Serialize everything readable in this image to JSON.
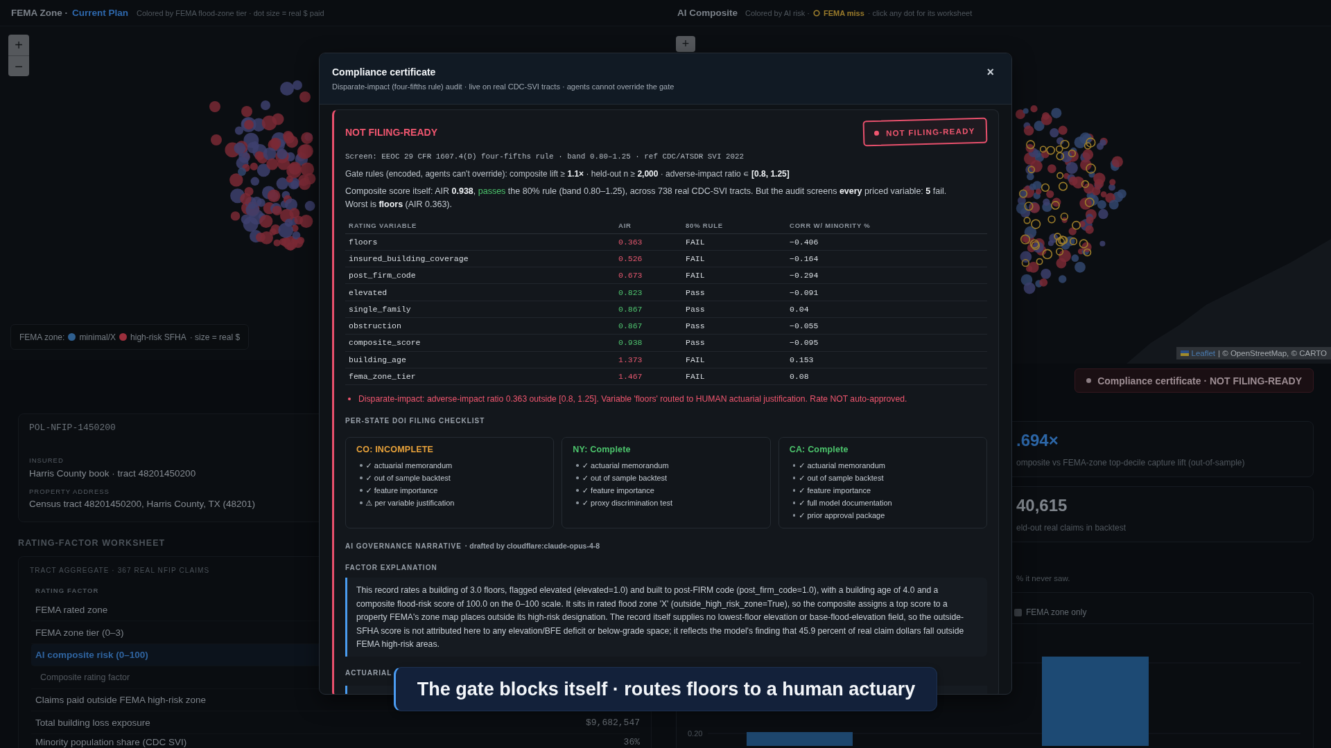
{
  "left_map": {
    "header": {
      "title": "FEMA Zone ·",
      "plan": "Current Plan",
      "caption": "Colored by FEMA flood-zone tier · dot size = real $ paid"
    },
    "zoom_buttons": [
      "+",
      "−"
    ],
    "legend": {
      "title": "FEMA zone:",
      "items": [
        {
          "label": "minimal/X",
          "color": "#2f5f8f"
        },
        {
          "label": "high-risk SFHA",
          "color": "#9a2f3c"
        }
      ],
      "note": "· size = real $"
    }
  },
  "right_map": {
    "header": {
      "title": "AI Composite",
      "caption": "Colored by AI risk ·",
      "miss_label": "FEMA miss",
      "note": "· click any dot for its worksheet"
    },
    "zoom_buttons": [
      "+"
    ],
    "attribution": {
      "link": "Leaflet",
      "text": "| © OpenStreetMap, © CARTO"
    }
  },
  "policy_card": {
    "policy_id": "POL-NFIP-1450200",
    "fields": [
      {
        "label": "INSURED",
        "value": "Harris County book · tract 48201450200"
      },
      {
        "label": "PROPERTY ADDRESS",
        "value": "Census tract 48201450200, Harris County, TX (48201)"
      }
    ]
  },
  "worksheet": {
    "title": "RATING-FACTOR WORKSHEET",
    "group": "TRACT AGGREGATE · 367 REAL NFIP CLAIMS",
    "column": "RATING FACTOR",
    "rows": [
      {
        "label": "FEMA rated zone",
        "kind": "factor",
        "selected": false
      },
      {
        "label": "FEMA zone tier (0–3)",
        "kind": "factor",
        "selected": false
      },
      {
        "label": "AI composite risk (0–100)",
        "kind": "factor",
        "selected": true
      },
      {
        "label": "Composite rating factor",
        "kind": "sub",
        "selected": false
      },
      {
        "label": "Claims paid outside FEMA high-risk zone",
        "kind": "factor",
        "selected": false
      },
      {
        "label": "Total building loss exposure",
        "kind": "factor",
        "selected": false,
        "value": "$9,682,547"
      },
      {
        "label": "Minority population share (CDC SVI)",
        "kind": "factor",
        "selected": false,
        "value": "36%"
      }
    ]
  },
  "compliance_button": {
    "label": "Compliance certificate · NOT FILING-READY"
  },
  "metrics": [
    {
      "value": ".694×",
      "caption": "omposite vs FEMA-zone top-decile capture lift (out-of-sample)",
      "kind": "accent"
    },
    {
      "value": "40,615",
      "caption": "eld-out real claims in backtest",
      "kind": "plain"
    }
  ],
  "note": "% it never saw.",
  "chart": {
    "legend": "FEMA zone only",
    "tick": "0.20"
  },
  "certificate": {
    "title": "Compliance certificate",
    "subtitle": "Disparate-impact (four-fifths rule) audit · live on real CDC-SVI tracts · agents cannot override the gate",
    "close": "×",
    "verdict": {
      "ready": false,
      "title": "NOT FILING-READY",
      "stamp": "NOT FILING-READY"
    },
    "screen": "Screen: EEOC 29 CFR 1607.4(D) four-fifths rule · band 0.80–1.25 · ref CDC/ATSDR SVI 2022",
    "gate_rules": "Gate rules (encoded, agents can't override): composite lift ≥ **1.1×** · held-out n ≥ **2,000** · adverse-impact ratio ∊ **[0.8, 1.25]**",
    "summary": [
      {
        "text": "Composite score itself: AIR **0.938**, ",
        "pass": false
      },
      {
        "text": "passes",
        "pass": true
      },
      {
        "text": " the 80% rule (band 0.80–1.25), across 738 real CDC-SVI tracts. But the audit screens **every** priced variable: **5** fail. Worst is **floors** (AIR 0.363).",
        "pass": false
      }
    ],
    "table": {
      "columns": [
        "RATING VARIABLE",
        "AIR",
        "80% RULE",
        "CORR W/ MINORITY %"
      ],
      "rows": [
        {
          "variable": "floors",
          "air": "0.363",
          "rule": "FAIL",
          "corr": "−0.406",
          "pass": false
        },
        {
          "variable": "insured_building_coverage",
          "air": "0.526",
          "rule": "FAIL",
          "corr": "−0.164",
          "pass": false
        },
        {
          "variable": "post_firm_code",
          "air": "0.673",
          "rule": "FAIL",
          "corr": "−0.294",
          "pass": false
        },
        {
          "variable": "elevated",
          "air": "0.823",
          "rule": "Pass",
          "corr": "−0.091",
          "pass": true
        },
        {
          "variable": "single_family",
          "air": "0.867",
          "rule": "Pass",
          "corr": "0.04",
          "pass": true
        },
        {
          "variable": "obstruction",
          "air": "0.867",
          "rule": "Pass",
          "corr": "−0.055",
          "pass": true
        },
        {
          "variable": "composite_score",
          "air": "0.938",
          "rule": "Pass",
          "corr": "−0.095",
          "pass": true
        },
        {
          "variable": "building_age",
          "air": "1.373",
          "rule": "FAIL",
          "corr": "0.153",
          "pass": false
        },
        {
          "variable": "fema_zone_tier",
          "air": "1.467",
          "rule": "FAIL",
          "corr": "0.08",
          "pass": false
        }
      ]
    },
    "alerts": [
      "Disparate-impact: adverse-impact ratio 0.363 outside [0.8, 1.25]. Variable 'floors' routed to HUMAN actuarial justification. Rate NOT auto-approved."
    ],
    "checklist": {
      "title": "PER-STATE DOI FILING CHECKLIST",
      "states": [
        {
          "title": "CO: INCOMPLETE",
          "complete": false,
          "items": [
            "✓ actuarial memorandum",
            "✓ out of sample backtest",
            "✓ feature importance",
            "⚠ per variable justification"
          ]
        },
        {
          "title": "NY: Complete",
          "complete": true,
          "items": [
            "✓ actuarial memorandum",
            "✓ out of sample backtest",
            "✓ feature importance",
            "✓ proxy discrimination test"
          ]
        },
        {
          "title": "CA: Complete",
          "complete": true,
          "items": [
            "✓ actuarial memorandum",
            "✓ out of sample backtest",
            "✓ feature importance",
            "✓ full model documentation",
            "✓ prior approval package"
          ]
        }
      ]
    },
    "narrative": {
      "title": "AI GOVERNANCE NARRATIVE",
      "drafter": "· drafted by cloudflare:claude-opus-4-8",
      "sections": [
        {
          "title": "FACTOR EXPLANATION",
          "text": "This record rates a building of 3.0 floors, flagged elevated (elevated=1.0) and built to post-FIRM code (post_firm_code=1.0), with a building age of 4.0 and a composite flood-risk score of 100.0 on the 0–100 scale. It sits in rated flood zone 'X' (outside_high_risk_zone=True), so the composite assigns a top score to a property FEMA's zone map places outside its high-risk designation. The record itself supplies no lowest-floor elevation or base-flood-elevation field, so the outside-SFHA score is not attributed here to any elevation/BFE deficit or below-grade space; it reflects the model's finding that 45.9 percent of real claim dollars fall outside FEMA high-risk areas."
        },
        {
          "title": "ACTUARIAL"
        }
      ]
    }
  },
  "caption_banner": "The gate blocks itself · routes floors to a human actuary"
}
